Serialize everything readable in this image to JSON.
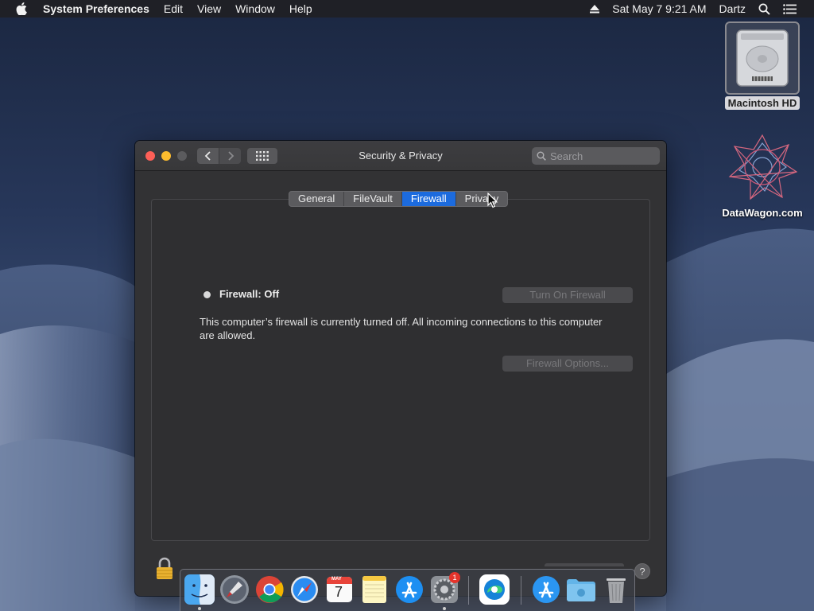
{
  "menubar": {
    "app_name": "System Preferences",
    "items": [
      "Edit",
      "View",
      "Window",
      "Help"
    ],
    "datetime": "Sat May 7  9:21 AM",
    "user": "Dartz"
  },
  "desktop": {
    "icons": [
      {
        "label": "Macintosh HD",
        "icon": "hard-drive-icon"
      },
      {
        "label": "DataWagon.com",
        "icon": "datawagon-icon"
      }
    ]
  },
  "window": {
    "title": "Security & Privacy",
    "search_placeholder": "Search",
    "tabs": [
      {
        "label": "General",
        "active": false
      },
      {
        "label": "FileVault",
        "active": false
      },
      {
        "label": "Firewall",
        "active": true
      },
      {
        "label": "Privacy",
        "active": false
      }
    ],
    "firewall": {
      "status_label": "Firewall: Off",
      "description": "This computer’s firewall is currently turned off. All incoming connections to this computer are allowed.",
      "turn_on_label": "Turn On Firewall",
      "options_label": "Firewall Options..."
    },
    "help_label": "?"
  },
  "dock": {
    "items": [
      "Finder",
      "Launchpad",
      "Google Chrome",
      "Safari",
      "Calendar",
      "Notes",
      "App Store",
      "System Preferences",
      "Microsoft Edge",
      "Applications",
      "Downloads",
      "Trash"
    ],
    "calendar_month": "MAY",
    "calendar_day": "7",
    "badge_count": "1"
  },
  "colors": {
    "accent": "#1c6bde",
    "close": "#fd5f57",
    "minimize": "#fdbc2e"
  }
}
